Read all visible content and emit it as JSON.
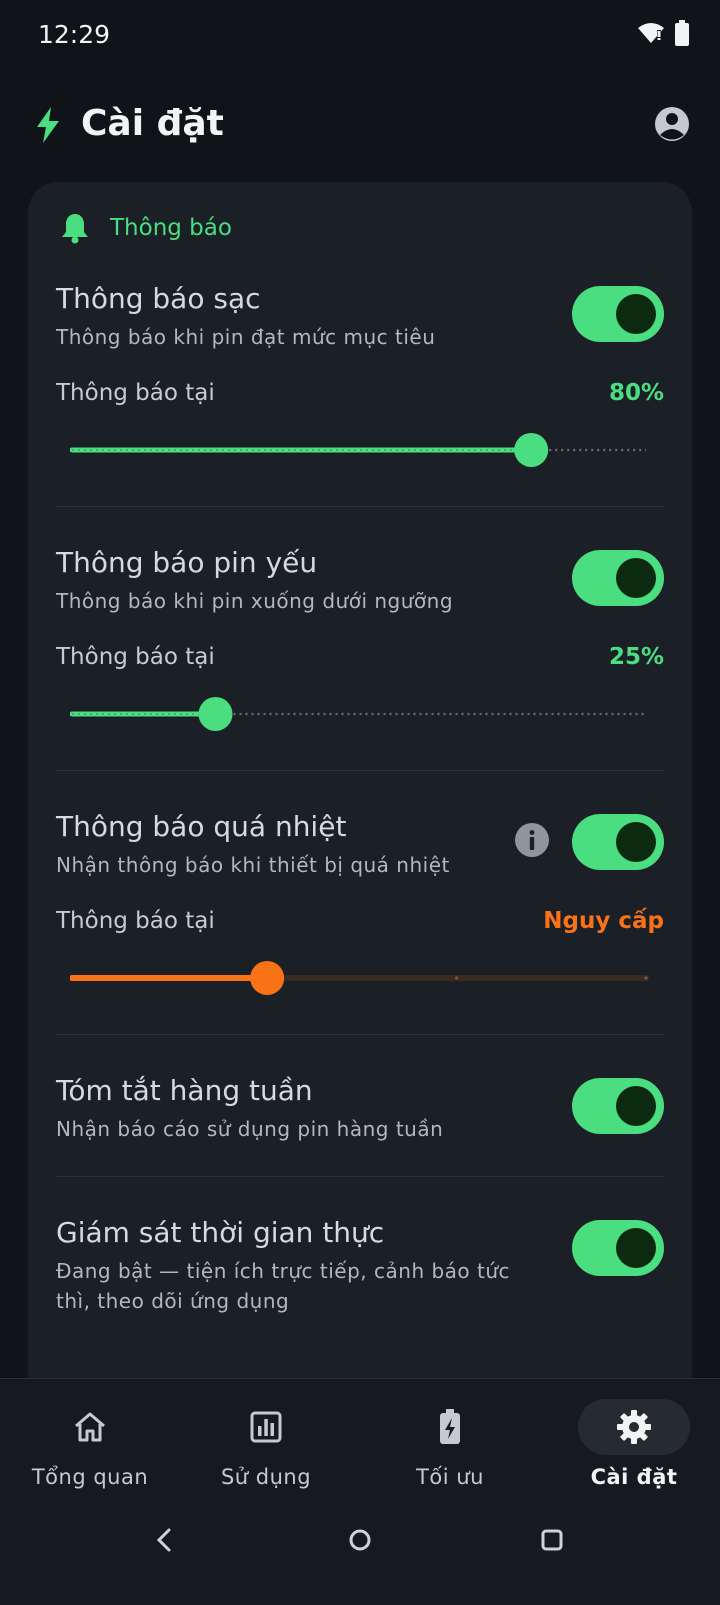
{
  "status": {
    "time": "12:29"
  },
  "header": {
    "title": "Cài đặt"
  },
  "section": {
    "label": "Thông báo"
  },
  "settings": [
    {
      "name": "Thông báo sạc",
      "desc": "Thông báo khi pin đạt mức mục tiêu",
      "enabled": true,
      "threshold_label": "Thông báo tại",
      "threshold_value": "80%",
      "slider_fraction": 0.8,
      "accent": "#4ade80"
    },
    {
      "name": "Thông báo pin yếu",
      "desc": "Thông báo khi pin xuống dưới ngưỡng",
      "enabled": true,
      "threshold_label": "Thông báo tại",
      "threshold_value": "25%",
      "slider_fraction": 0.25,
      "accent": "#4ade80"
    },
    {
      "name": "Thông báo quá nhiệt",
      "desc": "Nhận thông báo khi thiết bị quá nhiệt",
      "enabled": true,
      "threshold_label": "Thông báo tại",
      "threshold_value": "Nguy cấp",
      "slider_fraction": 0.34,
      "accent": "#f97316"
    },
    {
      "name": "Tóm tắt hàng tuần",
      "desc": "Nhận báo cáo sử dụng pin hàng tuần",
      "enabled": true
    },
    {
      "name": "Giám sát thời gian thực",
      "desc": "Đang bật — tiện ích trực tiếp, cảnh báo tức thì, theo dõi ứng dụng",
      "enabled": true
    }
  ],
  "nav": [
    {
      "label": "Tổng quan",
      "icon": "home-icon"
    },
    {
      "label": "Sử dụng",
      "icon": "bar-chart-icon"
    },
    {
      "label": "Tối ưu",
      "icon": "battery-bolt-icon"
    },
    {
      "label": "Cài đặt",
      "icon": "gear-icon",
      "active": true
    }
  ],
  "colors": {
    "accent_green": "#4ade80",
    "accent_orange": "#f97316",
    "card_bg": "#1b1f26",
    "page_bg": "#101318"
  }
}
